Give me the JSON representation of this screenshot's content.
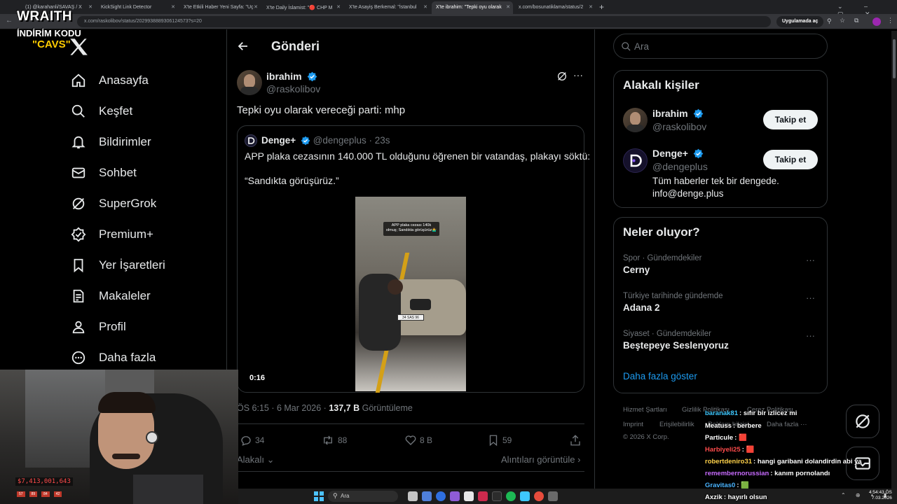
{
  "browser": {
    "tabs": [
      "(1) @karahanli/SAVAŞ / X",
      "KickSight Link Detector",
      "X'te Etkili Haber Yeni Sayfa: \"Uç",
      "X'te Daily İslamist: \"🔴 CHP M",
      "X'te Asayiş Berkemal: \"İstanbul",
      "X'te ibrahim: \"Tepki oyu olarak",
      "x.com/bosunatiklama/status/2"
    ],
    "url": "x.com/raskolibov/status/2029938889306124573?s=20",
    "app_button": "Uygulamada aç"
  },
  "overlay": {
    "brand_line1": "WRAITH",
    "brand_line2": "İNDİRİM KODU",
    "brand_line3": "\"CAVS\"",
    "money": "$7,413,001,643",
    "cam_stats": [
      "57",
      "89",
      "84",
      "42"
    ]
  },
  "nav": {
    "items": [
      {
        "label": "Anasayfa",
        "icon": "home-icon"
      },
      {
        "label": "Keşfet",
        "icon": "search-icon"
      },
      {
        "label": "Bildirimler",
        "icon": "bell-icon"
      },
      {
        "label": "Sohbet",
        "icon": "mail-icon"
      },
      {
        "label": "SuperGrok",
        "icon": "grok-icon"
      },
      {
        "label": "Premium+",
        "icon": "verified-badge-icon"
      },
      {
        "label": "Yer İşaretleri",
        "icon": "bookmark-icon"
      },
      {
        "label": "Makaleler",
        "icon": "article-icon"
      },
      {
        "label": "Profil",
        "icon": "person-icon"
      },
      {
        "label": "Daha fazla",
        "icon": "more-circle-icon"
      }
    ]
  },
  "post": {
    "header": "Gönderi",
    "author_name": "ibrahim",
    "author_handle": "@raskolibov",
    "text": "Tepki oyu olarak vereceği parti: mhp",
    "quote": {
      "name": "Denge+",
      "handle": "@dengeplus",
      "time": "· 23s",
      "text1": "APP plaka cezasının 140.000 TL olduğunu öğrenen bir vatandaş, plakayı söktü:",
      "text2": "“Sandıkta görüşürüz.”",
      "video_caption": "APP plaka cezası 140k olmuş; Sandıkta görüşürüz🤷‍♂️",
      "plate": "34 SAS 96",
      "duration": "0:16"
    },
    "meta_time": "ÖS 6:15 · 6 Mar 2026 ·",
    "views_value": "137,7 B",
    "views_label": "Görüntüleme",
    "replies": "34",
    "reposts": "88",
    "likes": "8 B",
    "bookmarks": "59",
    "sort_label": "Alakalı",
    "quotes_link": "Alıntıları görüntüle"
  },
  "right": {
    "search_placeholder": "Ara",
    "related_title": "Alakalı kişiler",
    "people": [
      {
        "name": "ibrahim",
        "handle": "@raskolibov",
        "bio": "",
        "button": "Takip et"
      },
      {
        "name": "Denge+",
        "handle": "@dengeplus",
        "bio": "Tüm haberler tek bir dengede. info@denge.plus",
        "button": "Takip et"
      }
    ],
    "trends_title": "Neler oluyor?",
    "trends": [
      {
        "category": "Spor · Gündemdekiler",
        "name": "Cerny"
      },
      {
        "category": "Türkiye tarihinde gündemde",
        "name": "Adana 2"
      },
      {
        "category": "Siyaset · Gündemdekiler",
        "name": "Beştepeye Seslenyoruz"
      }
    ],
    "show_more": "Daha fazla göster",
    "footer": {
      "terms": "Hizmet Şartları",
      "privacy": "Gizlilik Politikası",
      "cookies": "Çerez Politikası",
      "imprint": "Imprint",
      "accessibility": "Erişilebilirlik",
      "ads": "Reklam bilgisi",
      "more": "Daha fazla ···",
      "copyright": "© 2026 X Corp."
    }
  },
  "chat": [
    {
      "user": "baranak81",
      "color": "#3ec8ff",
      "msg": ": sıfır bir izlicez mi"
    },
    {
      "user": "Meatuss",
      "color": "#ffffff",
      "msg": ": berbere"
    },
    {
      "user": "Particule",
      "color": "#ffffff",
      "msg": ": 🟥"
    },
    {
      "user": "Harbiyeli25",
      "color": "#ff4b4b",
      "msg": ": 🟥"
    },
    {
      "user": "robertdeniro31",
      "color": "#ffd24a",
      "msg": ": hangi garibani dolandirdin abi ya"
    },
    {
      "user": "remembernorussian",
      "color": "#c86bff",
      "msg": ": kanım pornolandı"
    },
    {
      "user": "Gravitas0",
      "color": "#4ab4ff",
      "msg": ": 🟩"
    },
    {
      "user": "Axzik",
      "color": "#ffffff",
      "msg": ": hayırlı olsun"
    }
  ],
  "taskbar": {
    "search": "Ara",
    "time": "4:54:43 ÖS",
    "date": "7.03.2026"
  },
  "colors": {
    "accent": "#1d9bf0",
    "background": "#000000",
    "border": "#2f3336",
    "muted": "#71767b"
  }
}
